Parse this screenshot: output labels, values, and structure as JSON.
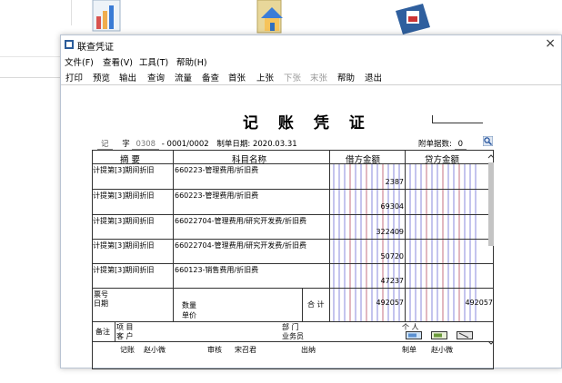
{
  "window": {
    "title": "联查凭证",
    "close": "×"
  },
  "menu": {
    "file": "文件(F)",
    "view": "查看(V)",
    "tools": "工具(T)",
    "help": "帮助(H)"
  },
  "toolbar": {
    "print": "打印",
    "preview": "预览",
    "export": "输出",
    "query": "查询",
    "flow": "流量",
    "backup": "备查",
    "first": "首张",
    "prev": "上张",
    "next": "下张",
    "last": "末张",
    "help": "帮助",
    "exit": "退出"
  },
  "voucher": {
    "title": "记 账 凭 证",
    "type": "记",
    "zi": "字",
    "number_code": "0308",
    "sequence": "- 0001/0002",
    "date_label": "制单日期:",
    "date": "2020.03.31",
    "attach_label": "附单据数:",
    "attach_count": "0",
    "col_summary": "摘 要",
    "col_account": "科目名称",
    "col_debit": "借方金额",
    "col_credit": "贷方金额",
    "entries": [
      {
        "summary": "计提第[3]期间折旧",
        "account": "660223-管理费用/折旧费",
        "debit": "2387"
      },
      {
        "summary": "计提第[3]期间折旧",
        "account": "660223-管理费用/折旧费",
        "debit": "69304"
      },
      {
        "summary": "计提第[3]期间折旧",
        "account": "66022704-管理费用/研究开发费/折旧费",
        "debit": "322409"
      },
      {
        "summary": "计提第[3]期间折旧",
        "account": "66022704-管理费用/研究开发费/折旧费",
        "debit": "50720"
      },
      {
        "summary": "计提第[3]期间折旧",
        "account": "660123-销售费用/折旧费",
        "debit": "47237"
      }
    ],
    "bill_no_label": "票号",
    "bill_date_label": "日期",
    "qty_label": "数量",
    "price_label": "单价",
    "total_label": "合 计",
    "total_debit": "492057",
    "total_credit": "492057",
    "remark_label": "备注",
    "project_label": "项 目",
    "customer_label": "客 户",
    "dept_label": "部 门",
    "staff_label": "业务员",
    "person_label": "个 人",
    "booker_label": "记账",
    "booker": "赵小微",
    "auditor_label": "审核",
    "auditor": "宋召君",
    "cashier_label": "出纳",
    "maker_label": "制单",
    "maker": "赵小微"
  }
}
